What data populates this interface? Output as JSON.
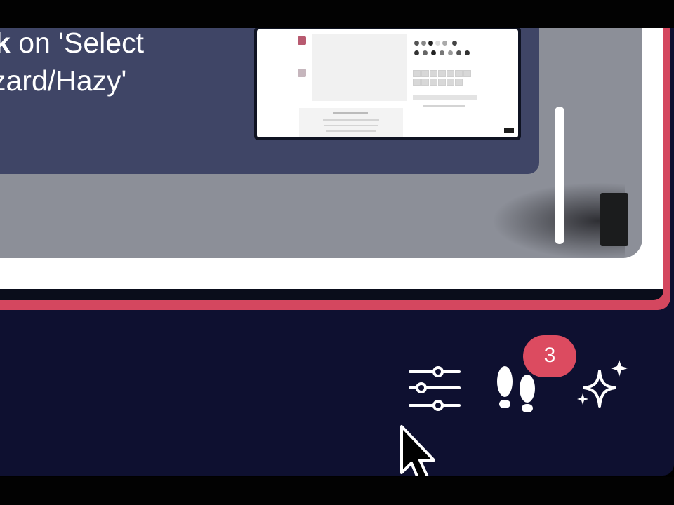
{
  "tutorial": {
    "step_line1_bold": "k",
    "step_line1_rest": " on 'Select",
    "step_line2": "zard/Hazy'"
  },
  "toolbar": {
    "settings_icon": "sliders-icon",
    "steps_icon": "footsteps-icon",
    "steps_badge": "3",
    "ai_icon": "sparkles-icon"
  },
  "colors": {
    "window_bg": "#0e1030",
    "frame_accent": "#d4475f",
    "badge": "#dc4b60",
    "card": "#3f4566"
  }
}
